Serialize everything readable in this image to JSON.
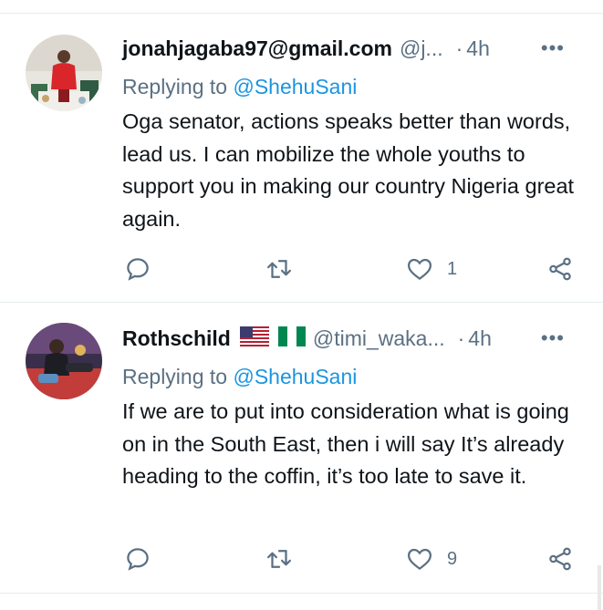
{
  "tweets": [
    {
      "name": "jonahjagaba97@gmail.com",
      "handle": "@j...",
      "dot": "·",
      "time": "4h",
      "more": "•••",
      "replying_prefix": "Replying to ",
      "replying_mention": "@ShehuSani",
      "text": "Oga senator, actions speaks better than words, lead us. I can mobilize the whole youths to support you in making our country Nigeria great again.",
      "like_count": "1",
      "icons": [
        "reply-icon",
        "retweet-icon",
        "like-icon",
        "share-icon",
        "more-icon"
      ]
    },
    {
      "name": "Rothschild",
      "flags": [
        "us-flag-icon",
        "nigeria-flag-icon"
      ],
      "handle": "@timi_waka...",
      "dot": "·",
      "time": "4h",
      "more": "•••",
      "replying_prefix": "Replying to ",
      "replying_mention": "@ShehuSani",
      "text": "If we are to put into consideration what is going on in the South East, then i will say It’s already heading to the coffin, it’s too late to save it.",
      "like_count": "9",
      "icons": [
        "reply-icon",
        "retweet-icon",
        "like-icon",
        "share-icon",
        "more-icon"
      ]
    }
  ],
  "colors": {
    "text": "#0f1419",
    "secondary": "#5b7083",
    "link": "#1b95e0",
    "divider": "#e6ecf0"
  }
}
